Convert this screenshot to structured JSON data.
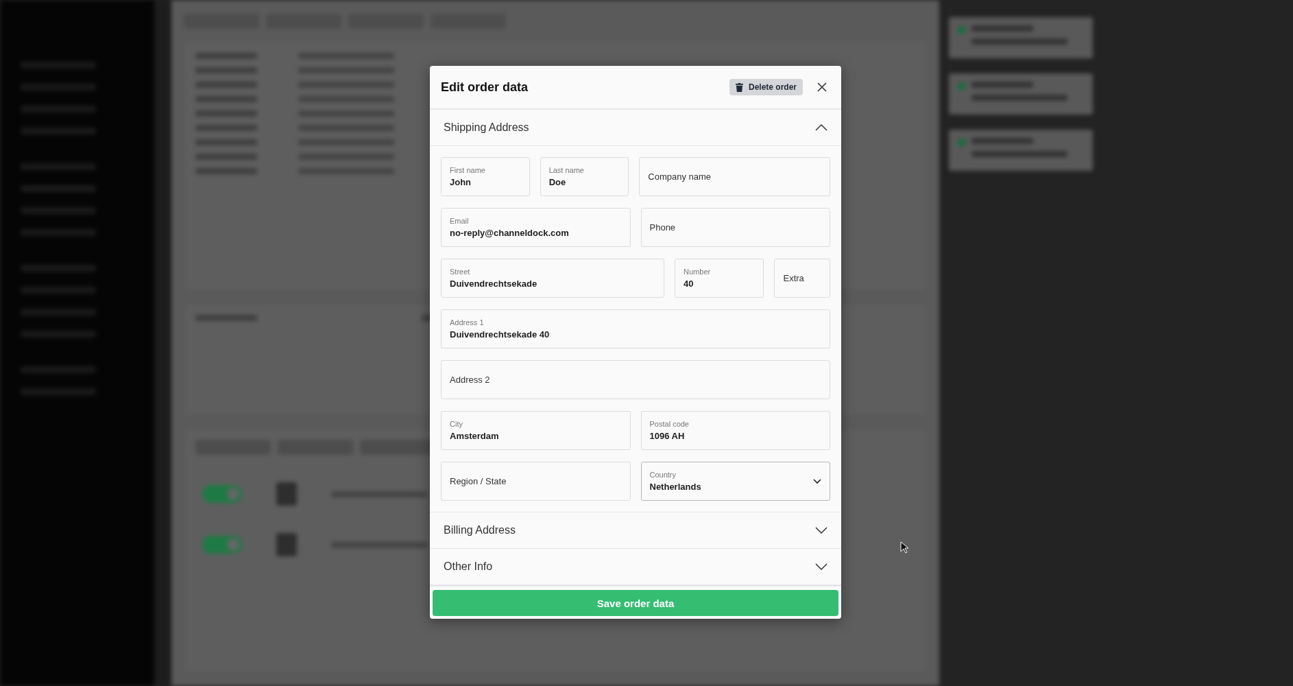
{
  "dialog": {
    "title": "Edit order data",
    "delete_button": "Delete order",
    "save_button": "Save order data"
  },
  "sections": [
    {
      "title": "Shipping Address",
      "expanded": true,
      "fields": [
        {
          "label": "First name",
          "value": "John",
          "kind": "text"
        },
        {
          "label": "Last name",
          "value": "Doe",
          "kind": "text"
        },
        {
          "placeholder": "Company name",
          "kind": "text"
        },
        {
          "label": "Email",
          "value": "no-reply@channeldock.com",
          "kind": "text"
        },
        {
          "placeholder": "Phone",
          "kind": "text"
        },
        {
          "label": "Street",
          "value": "Duivendrechtsekade",
          "kind": "text"
        },
        {
          "label": "Number",
          "value": "40",
          "kind": "text"
        },
        {
          "placeholder": "Extra",
          "kind": "text"
        },
        {
          "label": "Address 1",
          "value": "Duivendrechtsekade 40",
          "kind": "text"
        },
        {
          "placeholder": "Address 2",
          "kind": "text"
        },
        {
          "label": "City",
          "value": "Amsterdam",
          "kind": "text"
        },
        {
          "label": "Postal code",
          "value": "1096 AH",
          "kind": "text"
        },
        {
          "placeholder": "Region / State",
          "kind": "text"
        },
        {
          "label": "Country",
          "value": "Netherlands",
          "kind": "select"
        }
      ]
    },
    {
      "title": "Billing Address",
      "expanded": false
    },
    {
      "title": "Other Info",
      "expanded": false
    }
  ]
}
